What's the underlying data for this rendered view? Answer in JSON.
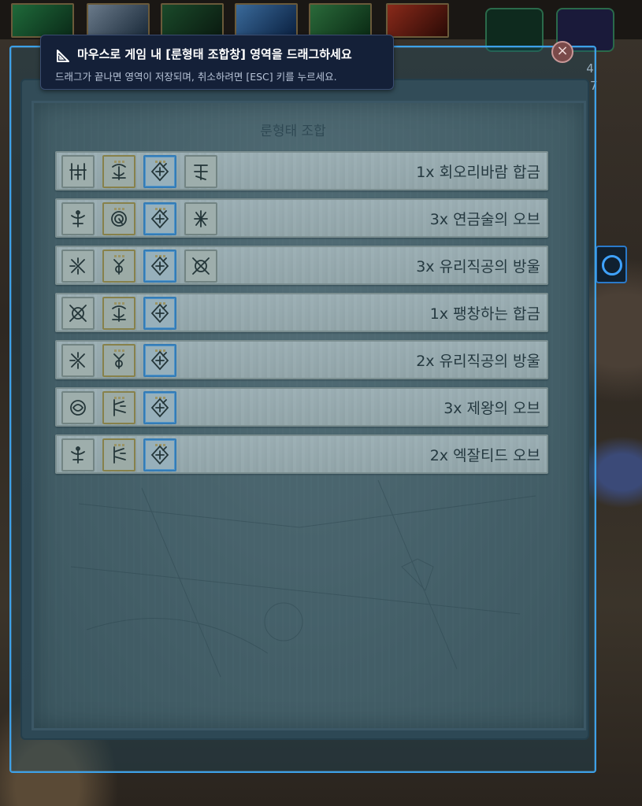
{
  "tooltip": {
    "title": "마우스로 게임 내 [룬형태 조합창] 영역을 드래그하세요",
    "subtitle": "드래그가 끝나면 영역이 저장되며, 취소하려면 [ESC] 키를 누르세요.",
    "icon": "ruler-triangle-icon"
  },
  "close_icon": "×",
  "side_counter": [
    "4",
    "07"
  ],
  "panel": {
    "title": "룬형태 조합"
  },
  "recipes": [
    {
      "label": "1x 회오리바람 합금",
      "runes": [
        "a",
        "b",
        "c",
        "d"
      ]
    },
    {
      "label": "3x 연금술의 오브",
      "runes": [
        "e",
        "f",
        "c",
        "g"
      ]
    },
    {
      "label": "3x 유리직공의 방울",
      "runes": [
        "h",
        "i",
        "c",
        "j"
      ]
    },
    {
      "label": "1x 팽창하는 합금",
      "runes": [
        "j",
        "b",
        "c"
      ]
    },
    {
      "label": "2x 유리직공의 방울",
      "runes": [
        "h",
        "i",
        "c"
      ]
    },
    {
      "label": "3x 제왕의 오브",
      "runes": [
        "k",
        "l",
        "c"
      ]
    },
    {
      "label": "2x 엑잘티드 오브",
      "runes": [
        "e",
        "l",
        "c"
      ]
    }
  ],
  "colors": {
    "selection_border": "#3ca0e8",
    "tooltip_bg": "#142038",
    "rune_gold": "#b8963c",
    "rune_blue": "#3f8fd6"
  }
}
